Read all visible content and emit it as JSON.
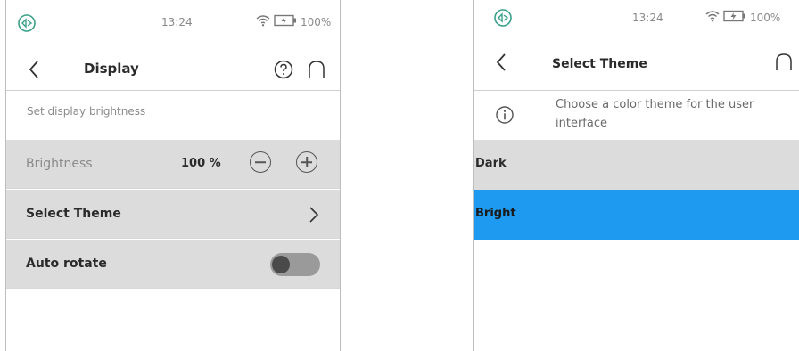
{
  "status": {
    "time": "13:24",
    "battery_percent": "100%"
  },
  "display_screen": {
    "title": "Display",
    "hint": "Set display brightness",
    "brightness": {
      "label": "Brightness",
      "value": "100 %"
    },
    "select_theme": {
      "label": "Select Theme"
    },
    "auto_rotate": {
      "label": "Auto rotate",
      "enabled": false
    }
  },
  "theme_screen": {
    "title": "Select Theme",
    "info": "Choose a color theme for the user interface",
    "options": [
      {
        "label": "Dark",
        "selected": false
      },
      {
        "label": "Bright",
        "selected": true
      }
    ],
    "colors": {
      "selected": "#1e9bf0",
      "option_bg": "#dcdcdc"
    }
  }
}
